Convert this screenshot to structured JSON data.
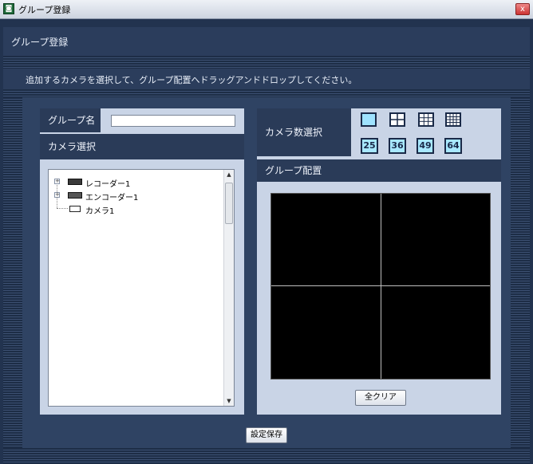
{
  "window": {
    "title": "グループ登録",
    "close_glyph": "x"
  },
  "header": {
    "title": "グループ登録"
  },
  "instruction": "追加するカメラを選択して、グループ配置へドラッグアンドドロップしてください。",
  "left": {
    "group_name_label": "グループ名",
    "group_name_value": "",
    "camera_select_label": "カメラ選択",
    "tree": [
      {
        "label": "レコーダー1",
        "icon": "recorder-icon"
      },
      {
        "label": "エンコーダー1",
        "icon": "encoder-icon"
      },
      {
        "label": "カメラ1",
        "icon": "camera-icon"
      }
    ]
  },
  "right": {
    "camera_count_label": "カメラ数選択",
    "layouts": [
      "1",
      "4",
      "9",
      "16",
      "25",
      "36",
      "49",
      "64"
    ],
    "selected_layout": "1",
    "group_layout_label": "グループ配置",
    "clear_all_label": "全クリア"
  },
  "footer": {
    "save_label": "設定保存"
  },
  "colors": {
    "background": "#22334f",
    "panel": "#c9d4e6",
    "label": "#2a3b58",
    "accent": "#a8e8ff"
  }
}
